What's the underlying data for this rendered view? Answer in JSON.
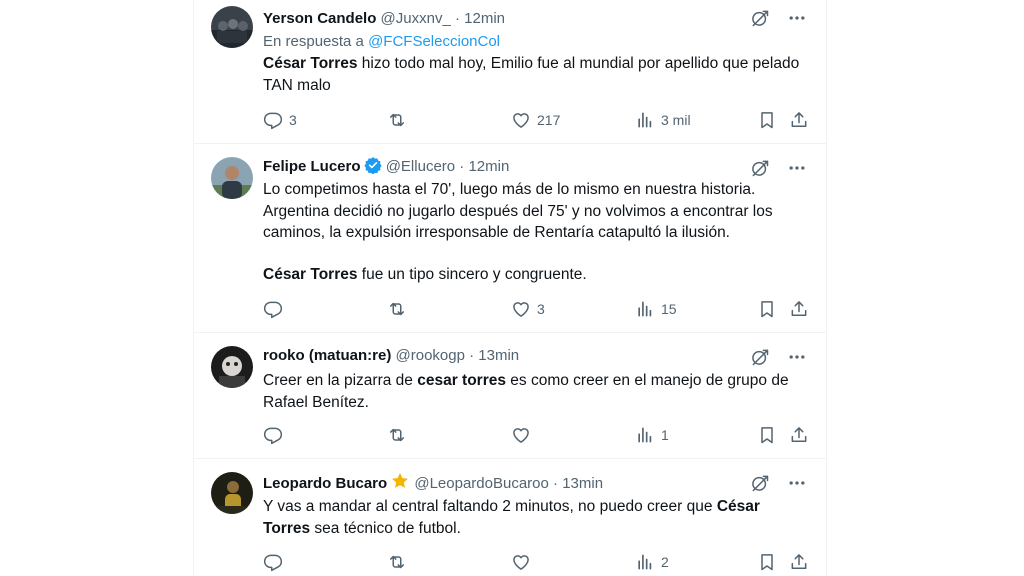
{
  "tweets": [
    {
      "name": "Yerson Candelo",
      "handle": "@Juxxnv_",
      "dot": "·",
      "time": "12min",
      "reply_prefix": "En respuesta a",
      "reply_mention": "@FCFSeleccionCol",
      "bold_name": "César Torres",
      "text_rest": " hizo todo mal hoy, Emilio fue al mundial por apellido que pelado TAN malo",
      "replies": "3",
      "retweets": "",
      "likes": "217",
      "views": "3 mil"
    },
    {
      "name": "Felipe Lucero",
      "verified": true,
      "handle": "@Ellucero",
      "dot": "·",
      "time": "12min",
      "paragraph1": "Lo competimos hasta el 70', luego más de lo mismo en nuestra historia. Argentina decidió no jugarlo después del 75' y no volvimos a encontrar los caminos, la expulsión irresponsable de Rentaría catapultó la ilusión.",
      "bold_name": "César Torres",
      "paragraph2_rest": " fue un tipo sincero y congruente.",
      "replies": "",
      "retweets": "",
      "likes": "3",
      "views": "15"
    },
    {
      "name": "rooko (matuan:re)",
      "handle": "@rookogp",
      "dot": "·",
      "time": "13min",
      "text_before": "Creer en la pizarra de ",
      "bold_name": "cesar torres",
      "text_after": " es como creer en el manejo de grupo de Rafael Benítez.",
      "replies": "",
      "retweets": "",
      "likes": "",
      "views": "1"
    },
    {
      "name": "Leopardo Bucaro",
      "star_badge": true,
      "handle": "@LeopardoBucaroo",
      "dot": "·",
      "time": "13min",
      "text_before": "Y vas a mandar al central faltando 2 minutos, no puedo creer que ",
      "bold_name": "César Torres",
      "text_after": " sea técnico de futbol.",
      "replies": "",
      "retweets": "",
      "likes": "",
      "views": "2"
    }
  ],
  "colors": {
    "text": "#0f1419",
    "secondary": "#536471",
    "link": "#1d9bf0",
    "verified": "#1d9bf0",
    "star": "#f4b400"
  },
  "icons": [
    "grok-icon",
    "more-icon",
    "reply-icon",
    "retweet-icon",
    "like-icon",
    "views-icon",
    "bookmark-icon",
    "share-icon",
    "verified-badge-icon",
    "star-badge-icon"
  ]
}
